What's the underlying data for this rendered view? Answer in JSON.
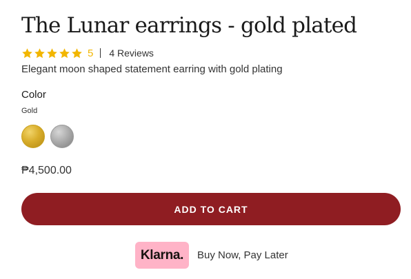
{
  "product": {
    "title": "The Lunar earrings - gold plated",
    "rating": {
      "stars": 5,
      "max_stars": 5,
      "value": "5",
      "reviews_label": "4 Reviews",
      "star_color": "#f2b600"
    },
    "description": "Elegant moon shaped statement earring with gold plating",
    "option": {
      "label": "Color",
      "selected_value": "Gold",
      "swatches": [
        {
          "name": "Gold",
          "color": "#d9ae2c"
        },
        {
          "name": "Silver",
          "color": "#a9a9a9"
        }
      ]
    },
    "price": "₱4,500.00",
    "add_to_cart_label": "ADD TO CART",
    "klarna": {
      "logo_text": "Klarna.",
      "tagline": "Buy Now, Pay Later",
      "badge_color": "#ffb3c7"
    }
  },
  "colors": {
    "button_background": "#8f1d22",
    "button_text": "#ffffff"
  }
}
